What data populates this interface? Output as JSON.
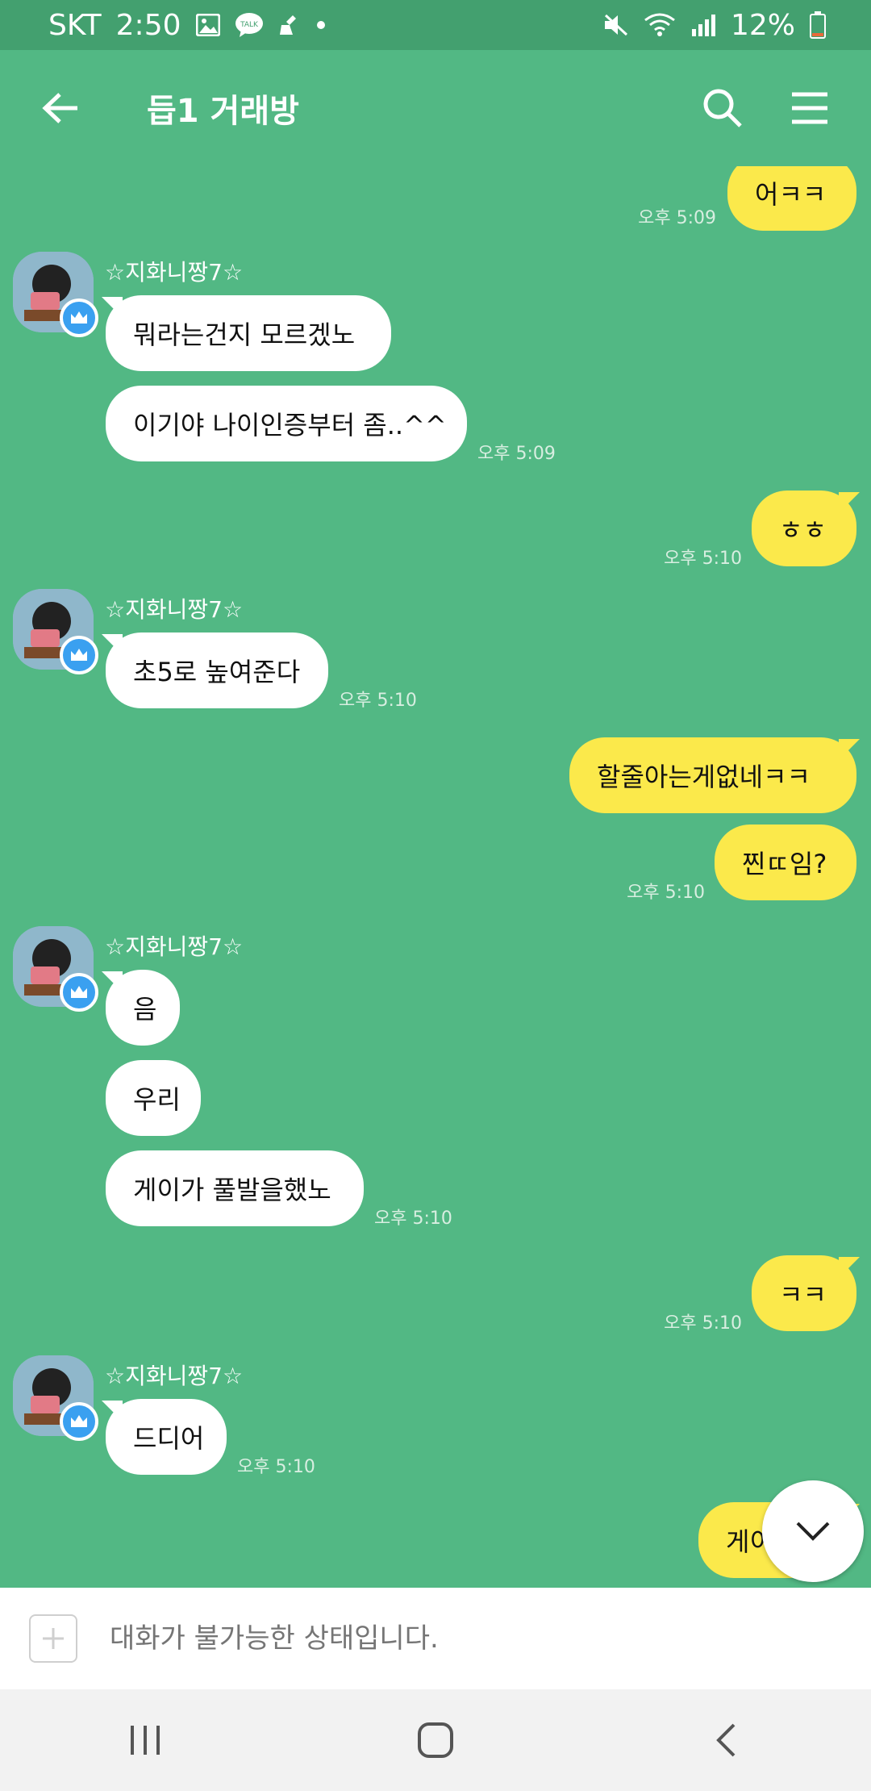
{
  "status_bar": {
    "carrier": "SKT",
    "time": "2:50",
    "battery": "12%",
    "icons": [
      "gallery-icon",
      "talk-icon",
      "cleaner-icon",
      "dot-icon",
      "mute-icon",
      "wifi-icon",
      "signal-icon",
      "battery-icon"
    ]
  },
  "header": {
    "title": "듭1 거래방",
    "icons": [
      "back-arrow-icon",
      "search-icon",
      "menu-icon"
    ]
  },
  "colors": {
    "background": "#52b884",
    "status_bar": "#43a06f",
    "incoming_bubble": "#ffffff",
    "outgoing_bubble": "#fbe94b"
  },
  "messages": [
    {
      "side": "out",
      "text": "어ㅋㅋ",
      "time": "오후 5:09"
    },
    {
      "side": "in",
      "sender": "☆지화니짱7☆",
      "text": "뭐라는건지 모르겠노"
    },
    {
      "side": "in",
      "text": "이기야 나이인증부터 좀..^^",
      "time": "오후 5:09"
    },
    {
      "side": "out",
      "text": "ㅎㅎ",
      "time": "오후 5:10"
    },
    {
      "side": "in",
      "sender": "☆지화니짱7☆",
      "text": "초5로 높여준다",
      "time": "오후 5:10"
    },
    {
      "side": "out",
      "text": "할줄아는게없네ㅋㅋ"
    },
    {
      "side": "out",
      "text": "찐ㄸ임?",
      "time": "오후 5:10"
    },
    {
      "side": "in",
      "sender": "☆지화니짱7☆",
      "text": "음"
    },
    {
      "side": "in",
      "text": "우리"
    },
    {
      "side": "in",
      "text": "게이가 풀발을했노",
      "time": "오후 5:10"
    },
    {
      "side": "out",
      "text": "ㅋㅋ",
      "time": "오후 5:10"
    },
    {
      "side": "in",
      "sender": "☆지화니짱7☆",
      "text": "드디어",
      "time": "오후 5:10"
    },
    {
      "side": "out",
      "text": "게이ㅋ"
    }
  ],
  "input": {
    "placeholder": "대화가 불가능한 상태입니다."
  },
  "nav": {
    "icons": [
      "recent-apps-icon",
      "home-icon",
      "back-icon"
    ]
  }
}
